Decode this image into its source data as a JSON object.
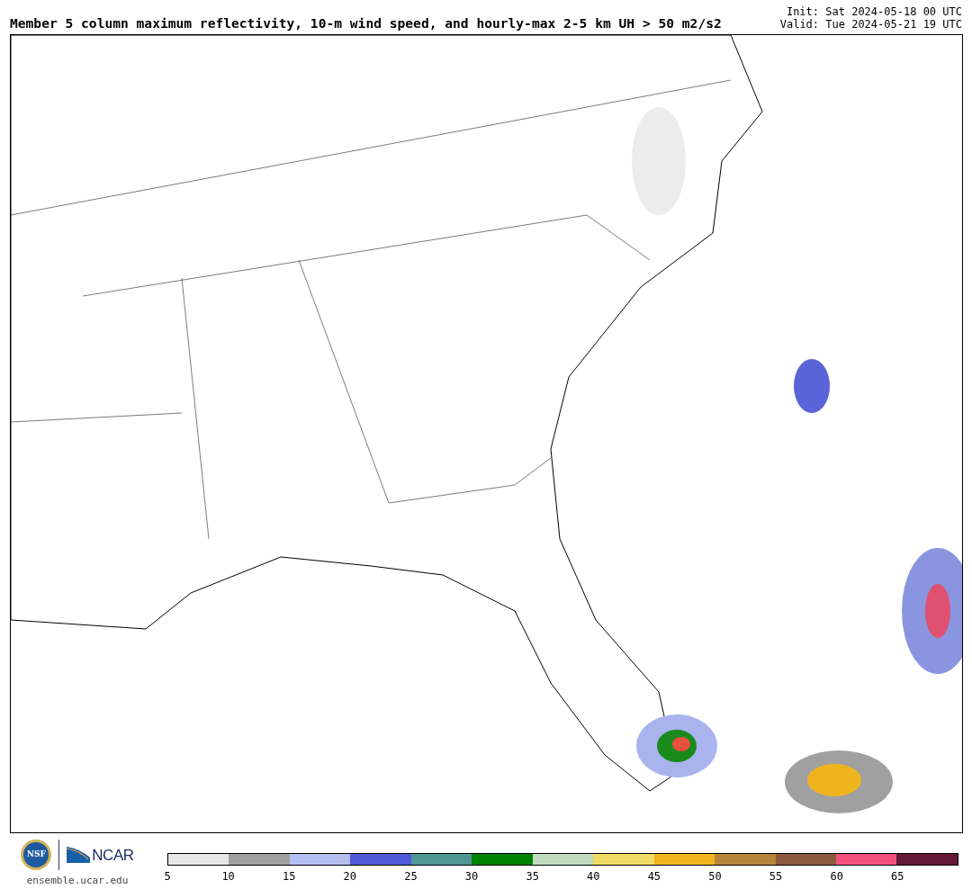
{
  "title": "Member 5 column maximum reflectivity, 10-m wind speed, and hourly-max 2-5 km UH > 50 m2/s2",
  "init": "Init: Sat 2024-05-18 00 UTC",
  "valid": "Valid: Tue 2024-05-21 19 UTC",
  "logos": {
    "nsf": "NSF",
    "ncar": "NCAR",
    "website": "ensemble.ucar.edu"
  },
  "colorbar": {
    "segments": [
      {
        "color": "#e6e6e6"
      },
      {
        "color": "#a0a0a0"
      },
      {
        "color": "#b4bef0"
      },
      {
        "color": "#505ad8"
      },
      {
        "color": "#4f9696"
      },
      {
        "color": "#008200"
      },
      {
        "color": "#bfdcbf"
      },
      {
        "color": "#f0dc64"
      },
      {
        "color": "#f0b41e"
      },
      {
        "color": "#b8863a"
      },
      {
        "color": "#8b5a3c"
      },
      {
        "color": "#f4507e"
      },
      {
        "color": "#641937"
      }
    ],
    "ticks": [
      "5",
      "10",
      "15",
      "20",
      "25",
      "30",
      "35",
      "40",
      "45",
      "50",
      "55",
      "60",
      "65"
    ]
  }
}
